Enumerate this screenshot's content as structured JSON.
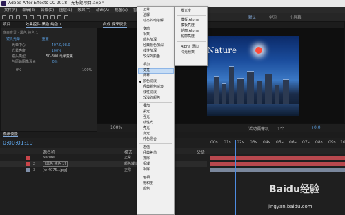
{
  "window": {
    "title": "Adobe After Effects CC 2018 - 无标题项目.aep *"
  },
  "menu": [
    "文件(F)",
    "编辑(E)",
    "合成(C)",
    "图层(L)",
    "效果(T)",
    "动画(A)",
    "视图(V)",
    "窗口"
  ],
  "workspaces": {
    "active": "默认",
    "items": [
      "学习",
      "小屏幕"
    ]
  },
  "project_panel": {
    "tab": "项目",
    "effects_tab": "效果控件 黑色 纯色 1",
    "path": "晚来夜景 · 黑色 纯色 1",
    "rows": [
      {
        "label": "镜头光晕",
        "value": "重置"
      },
      {
        "label": "光晕中心",
        "value": "407.0,98.0"
      },
      {
        "label": "光晕亮度",
        "value": "100%"
      },
      {
        "label": "镜头类型",
        "value": "50-300 毫米变焦"
      },
      {
        "label": "与原始图像混合",
        "value": "0%"
      }
    ],
    "slider_min": "0%",
    "slider_max": "100%"
  },
  "composition_panel": {
    "tab": "合成 晚来夜景",
    "overlay_text": "Nature",
    "zoom": "100%",
    "resolution": "完整",
    "camera": "活动摄像机",
    "views": "1个...",
    "exposure": "+0.0"
  },
  "timeline": {
    "tab": "晚来夜景",
    "timecode": "0:00:01:19",
    "columns": [
      "源名称",
      "模式",
      "父级"
    ],
    "layers": [
      {
        "index": "1",
        "name": "Nature",
        "mode": "正常",
        "color": "#c9454a"
      },
      {
        "index": "2",
        "name": "[黑色 纯色 1]",
        "mode": "颜色减淡",
        "color": "#c9454a"
      },
      {
        "index": "3",
        "name": "[w-4075...jpg]",
        "mode": "正常",
        "color": "#7f8fa8"
      }
    ],
    "ruler": [
      "00s",
      "01s",
      "02s",
      "03s",
      "04s",
      "05s",
      "06s",
      "07s",
      "08s",
      "09s",
      "10s"
    ]
  },
  "blend_menu": {
    "items": [
      "正常",
      "溶解",
      "动态抖动溶解",
      "变暗",
      "相乘",
      "颜色加深",
      "经典颜色加深",
      "线性加深",
      "较深的颜色",
      "相加",
      "变亮",
      "屏幕",
      "颜色减淡",
      "经典颜色减淡",
      "线性减淡",
      "较浅的颜色",
      "叠加",
      "柔光",
      "强光",
      "线性光",
      "亮光",
      "点光",
      "纯色混合",
      "差值",
      "经典差值",
      "排除",
      "相减",
      "相除",
      "色相",
      "饱和度",
      "颜色"
    ],
    "highlighted": "变亮",
    "checked": "颜色减淡"
  },
  "blend_submenu": {
    "items": [
      "发光度",
      "模板 Alpha",
      "模板亮度",
      "轮廓 Alpha",
      "轮廓亮度",
      "Alpha 添加",
      "冷光预乘"
    ]
  },
  "watermark": {
    "text": "Baidu经验",
    "url": "jingyan.baidu.com"
  }
}
